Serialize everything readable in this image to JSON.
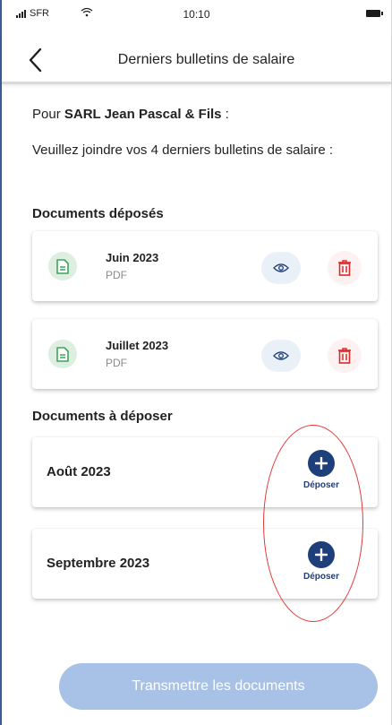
{
  "status_bar": {
    "carrier": "SFR",
    "time": "10:10"
  },
  "header": {
    "title": "Derniers bulletins de salaire"
  },
  "intro": {
    "prefix": "Pour ",
    "company": "SARL Jean Pascal & Fils",
    "suffix": " :",
    "instruction": "Veuillez joindre vos 4 derniers bulletins de salaire :"
  },
  "deposited": {
    "title": "Documents déposés",
    "items": [
      {
        "name": "Juin 2023",
        "type": "PDF"
      },
      {
        "name": "Juillet 2023",
        "type": "PDF"
      }
    ]
  },
  "to_upload": {
    "title": "Documents à déposer",
    "items": [
      {
        "name": "Août 2023",
        "action": "Déposer"
      },
      {
        "name": "Septembre 2023",
        "action": "Déposer"
      }
    ]
  },
  "submit_label": "Transmettre les documents",
  "colors": {
    "primary": "#1f3f7a",
    "disabled_button": "#a8c1e6",
    "doc_icon": "#3fa45b",
    "delete": "#d92b2b",
    "annotation": "#e23b3b"
  }
}
